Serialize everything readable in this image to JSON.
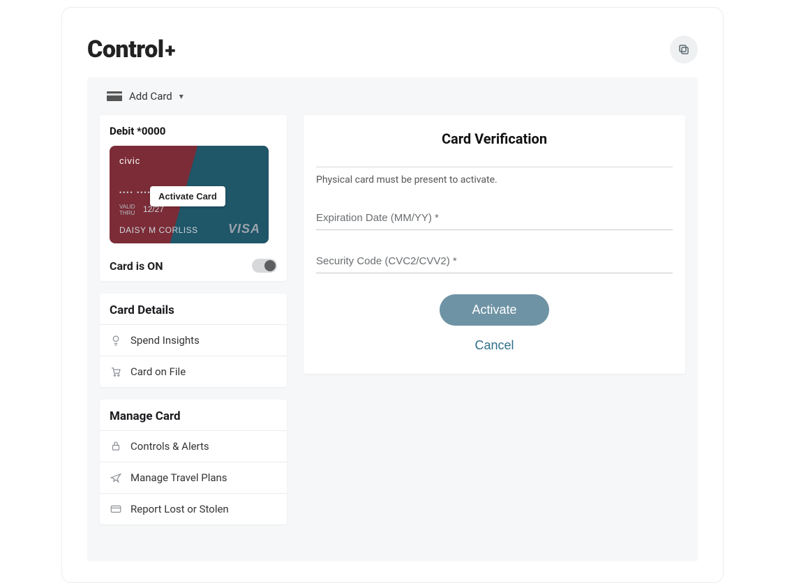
{
  "brand": {
    "name": "Control",
    "suffix": "+"
  },
  "toolbar": {
    "add_card_label": "Add Card"
  },
  "card": {
    "title": "Debit *0000",
    "bank": "civic",
    "masked": "•••• ••••",
    "valid_label": "VALID THRU",
    "expiry": "12/27",
    "holder": "DAISY M CORLISS",
    "network": "VISA",
    "activate_pill": "Activate Card",
    "status_label": "Card is ON"
  },
  "details_section": {
    "title": "Card Details",
    "items": [
      {
        "label": "Spend Insights"
      },
      {
        "label": "Card on File"
      }
    ]
  },
  "manage_section": {
    "title": "Manage Card",
    "items": [
      {
        "label": "Controls & Alerts"
      },
      {
        "label": "Manage Travel Plans"
      },
      {
        "label": "Report Lost or Stolen"
      }
    ]
  },
  "verify": {
    "title": "Card Verification",
    "note": "Physical card must be present to activate.",
    "expiry_placeholder": "Expiration Date (MM/YY) *",
    "cvc_placeholder": "Security Code (CVC2/CVV2) *",
    "activate_btn": "Activate",
    "cancel_btn": "Cancel"
  }
}
